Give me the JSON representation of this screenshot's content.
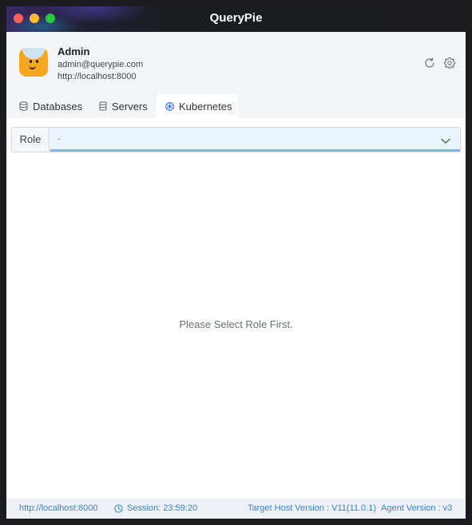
{
  "app": {
    "title": "QueryPie"
  },
  "user": {
    "name": "Admin",
    "email": "admin@querypie.com",
    "host": "http://localhost:8000"
  },
  "header_icons": [
    "refresh-icon",
    "gear-icon"
  ],
  "tabs": [
    {
      "label": "Databases",
      "icon": "database-icon",
      "active": false
    },
    {
      "label": "Servers",
      "icon": "server-icon",
      "active": false
    },
    {
      "label": "Kubernetes",
      "icon": "kubernetes-icon",
      "active": true
    }
  ],
  "role": {
    "label": "Role",
    "value": "-"
  },
  "main": {
    "empty_message": "Please Select Role First."
  },
  "status": {
    "host": "http://localhost:8000",
    "session": "Session: 23:59:20",
    "target_host_version": "Target Host Version : V11(11.0.1)",
    "agent_version": "Agent Version : v3"
  },
  "colors": {
    "accent": "#3b82c4",
    "kubernetes": "#326ce5",
    "select_bg": "#e9f5fd",
    "select_border": "#6cc0f0"
  }
}
